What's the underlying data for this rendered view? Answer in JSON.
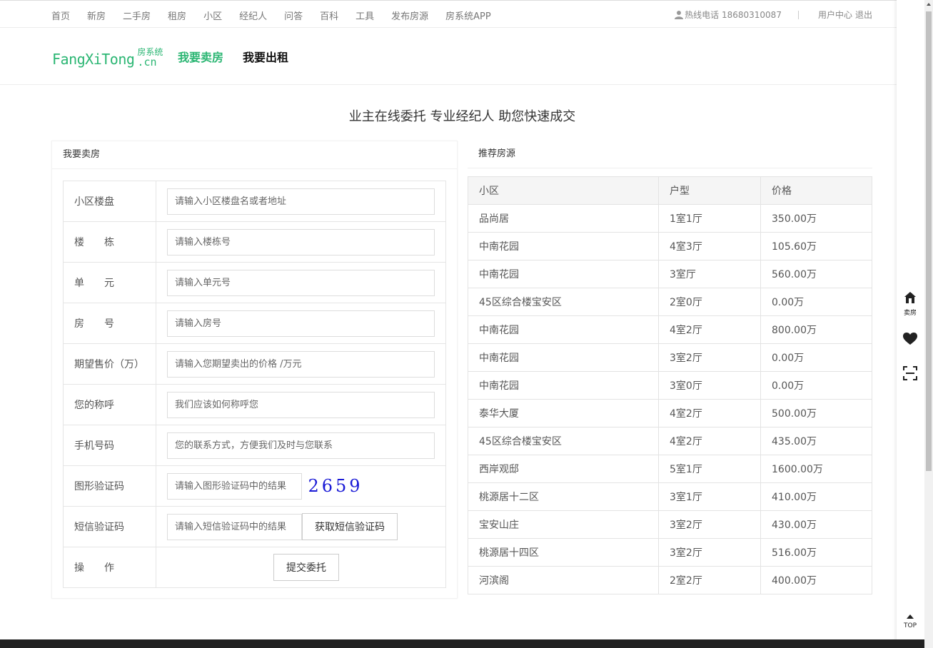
{
  "topnav": {
    "items": [
      "首页",
      "新房",
      "二手房",
      "租房",
      "小区",
      "经纪人",
      "问答",
      "百科",
      "工具",
      "发布房源",
      "房系统APP"
    ],
    "hotline": "热线电话 18680310087",
    "user_center": "用户中心",
    "logout": "退出"
  },
  "logo": {
    "en": "FangXiTong",
    "cn": "房系统",
    "suffix": ".cn"
  },
  "header_tabs": {
    "sell": "我要卖房",
    "rent": "我要出租"
  },
  "slogan": "业主在线委托 专业经纪人 助您快速成交",
  "sell_form": {
    "title": "我要卖房",
    "fields": [
      {
        "label": "小区楼盘",
        "placeholder": "请输入小区楼盘名或者地址"
      },
      {
        "label": "楼　　栋",
        "placeholder": "请输入楼栋号"
      },
      {
        "label": "单　　元",
        "placeholder": "请输入单元号"
      },
      {
        "label": "房　　号",
        "placeholder": "请输入房号"
      },
      {
        "label": "期望售价（万）",
        "placeholder": "请输入您期望卖出的价格 /万元"
      },
      {
        "label": "您的称呼",
        "placeholder": "我们应该如何称呼您"
      },
      {
        "label": "手机号码",
        "placeholder": "您的联系方式，方便我们及时与您联系"
      }
    ],
    "captcha": {
      "label": "图形验证码",
      "placeholder": "请输入图形验证码中的结果",
      "code": "2659"
    },
    "sms": {
      "label": "短信验证码",
      "placeholder": "请输入短信验证码中的结果",
      "button": "获取短信验证码"
    },
    "action": {
      "label": "操　　作",
      "button": "提交委托"
    }
  },
  "recommend": {
    "title": "推荐房源",
    "headers": [
      "小区",
      "户型",
      "价格"
    ],
    "rows": [
      [
        "品尚居",
        "1室1厅",
        "350.00万"
      ],
      [
        "中南花园",
        "4室3厅",
        "105.60万"
      ],
      [
        "中南花园",
        "3室厅",
        "560.00万"
      ],
      [
        "45区综合楼宝安区",
        "2室0厅",
        "0.00万"
      ],
      [
        "中南花园",
        "4室2厅",
        "800.00万"
      ],
      [
        "中南花园",
        "3室2厅",
        "0.00万"
      ],
      [
        "中南花园",
        "3室0厅",
        "0.00万"
      ],
      [
        "泰华大厦",
        "4室2厅",
        "500.00万"
      ],
      [
        "45区综合楼宝安区",
        "4室2厅",
        "435.00万"
      ],
      [
        "西岸观邸",
        "5室1厅",
        "1600.00万"
      ],
      [
        "桃源居十二区",
        "3室1厅",
        "410.00万"
      ],
      [
        "宝安山庄",
        "3室2厅",
        "430.00万"
      ],
      [
        "桃源居十四区",
        "3室2厅",
        "516.00万"
      ],
      [
        "河滨阁",
        "2室2厅",
        "400.00万"
      ]
    ]
  },
  "sidebar": {
    "sell_label": "卖房",
    "top_label": "TOP"
  },
  "colors": {
    "brand_green": "#2bb673",
    "captcha_blue": "#1a1ad6"
  }
}
